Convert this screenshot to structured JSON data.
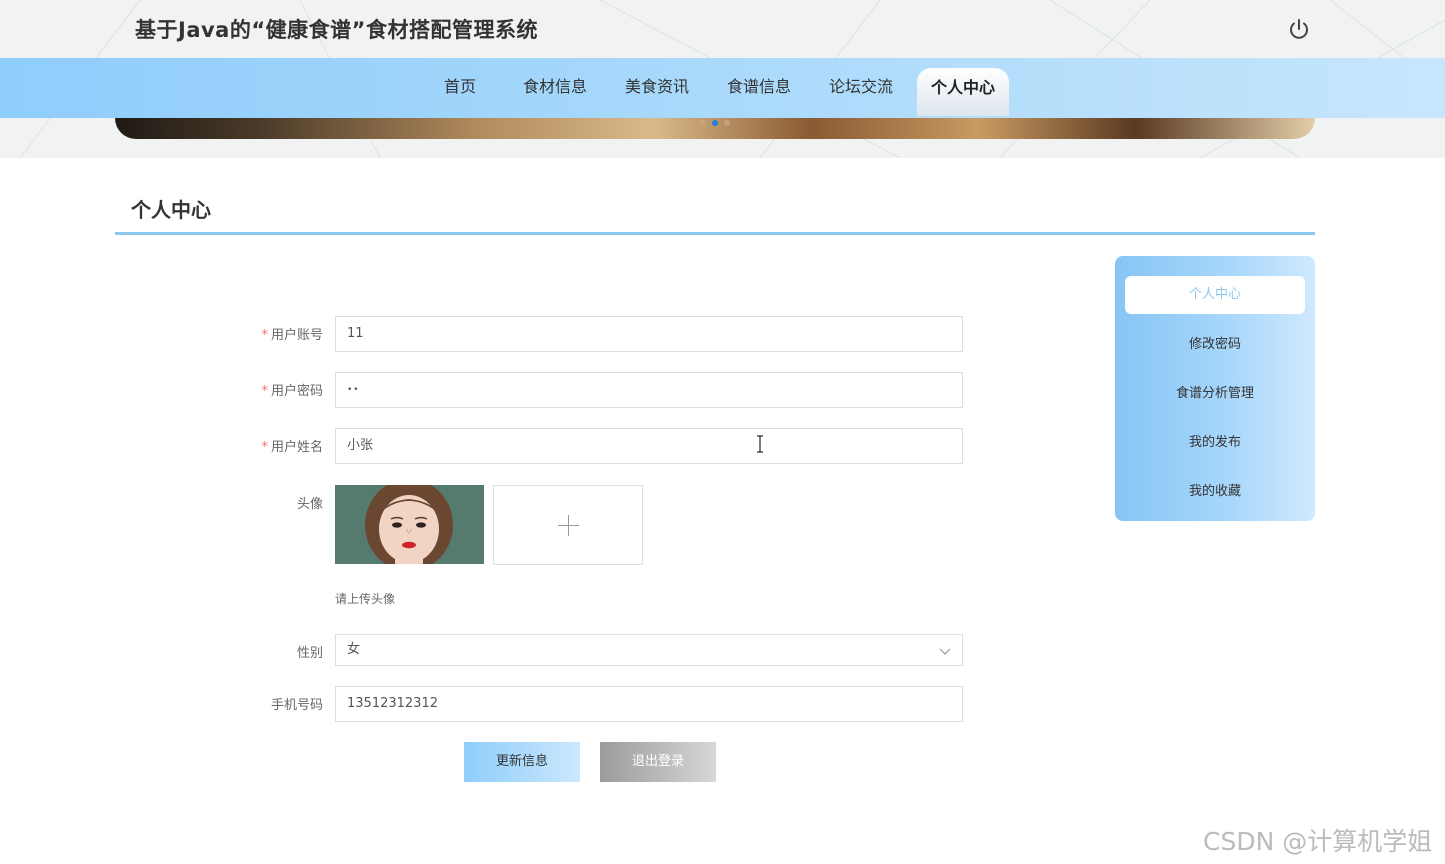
{
  "header": {
    "site_title": "基于Java的“健康食谱”食材搭配管理系统",
    "power_icon": "power-icon"
  },
  "nav": {
    "items": [
      {
        "label": "首页",
        "active": false
      },
      {
        "label": "食材信息",
        "active": false
      },
      {
        "label": "美食资讯",
        "active": false
      },
      {
        "label": "食谱信息",
        "active": false
      },
      {
        "label": "论坛交流",
        "active": false
      },
      {
        "label": "个人中心",
        "active": true
      }
    ]
  },
  "page": {
    "title": "个人中心"
  },
  "form": {
    "account": {
      "label": "用户账号",
      "required": true,
      "value": "11"
    },
    "password": {
      "label": "用户密码",
      "required": true,
      "value": "••"
    },
    "name": {
      "label": "用户姓名",
      "required": true,
      "value": "小张"
    },
    "avatar": {
      "label": "头像",
      "hint": "请上传头像"
    },
    "gender": {
      "label": "性别",
      "value": "女"
    },
    "phone": {
      "label": "手机号码",
      "value": "13512312312"
    },
    "update_label": "更新信息",
    "logout_label": "退出登录"
  },
  "sidebar": {
    "items": [
      {
        "label": "个人中心",
        "active": true
      },
      {
        "label": "修改密码",
        "active": false
      },
      {
        "label": "食谱分析管理",
        "active": false
      },
      {
        "label": "我的发布",
        "active": false
      },
      {
        "label": "我的收藏",
        "active": false
      }
    ]
  },
  "colors": {
    "accent": "#8cc8ee",
    "nav_bg": "#a7d8fb",
    "required": "#f56c6c"
  },
  "watermark": "CSDN @计算机学姐"
}
